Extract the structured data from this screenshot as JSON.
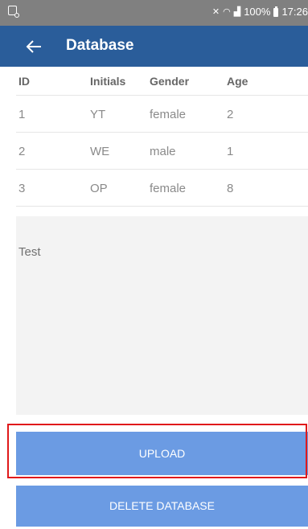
{
  "status_bar": {
    "time": "17:26",
    "battery": "100%",
    "icons": [
      "screenshot-icon",
      "mute-icon",
      "wifi-icon",
      "signal-icon",
      "battery-icon"
    ]
  },
  "app_bar": {
    "title": "Database",
    "back_icon": "arrow-left-icon",
    "color": "#2a5d9a"
  },
  "table": {
    "headers": [
      "ID",
      "Initials",
      "Gender",
      "Age"
    ],
    "rows": [
      [
        "1",
        "YT",
        "female",
        "2"
      ],
      [
        "2",
        "WE",
        "male",
        "1"
      ],
      [
        "3",
        "OP",
        "female",
        "8"
      ]
    ]
  },
  "panel": {
    "text": "Test"
  },
  "buttons": {
    "upload_label": "UPLOAD",
    "delete_label": "DELETE DATABASE",
    "color": "#6b9be3",
    "highlight_color": "#e0191b"
  }
}
